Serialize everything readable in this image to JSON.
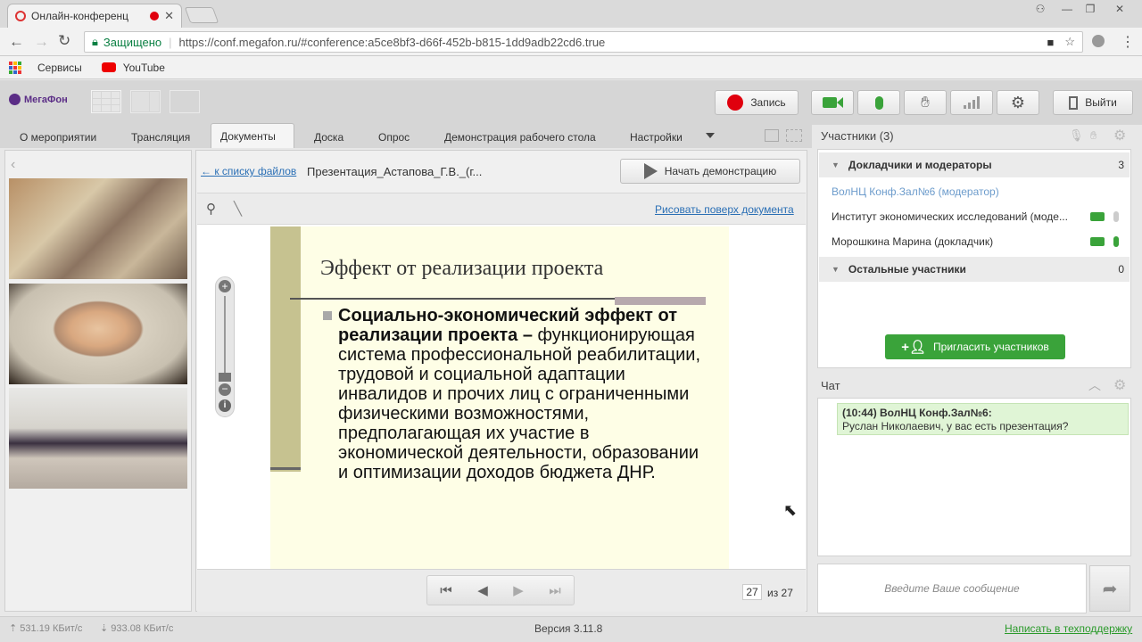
{
  "browser": {
    "tab_title": "Онлайн-конференц",
    "secure_label": "Защищено",
    "url": "https://conf.megafon.ru/#conference:a5ce8bf3-d66f-452b-b815-1dd9adb22cd6.true",
    "bookmarks": [
      {
        "label": "Сервисы"
      },
      {
        "label": "YouTube"
      }
    ]
  },
  "header": {
    "logo": "МегаФон",
    "record_label": "Запись",
    "logout_label": "Выйти"
  },
  "tabs": [
    {
      "label": "О мероприятии",
      "active": false
    },
    {
      "label": "Трансляция",
      "active": false
    },
    {
      "label": "Документы",
      "active": true
    },
    {
      "label": "Доска",
      "active": false
    },
    {
      "label": "Опрос",
      "active": false
    },
    {
      "label": "Демонстрация рабочего стола",
      "active": false
    },
    {
      "label": "Настройки",
      "active": false
    }
  ],
  "document": {
    "back_link": "← к списку файлов",
    "filename": "Презентация_Астапова_Г.В._(г...",
    "start_demo_label": "Начать демонстрацию",
    "draw_link": "Рисовать поверх документа",
    "slide": {
      "title": "Эффект от реализации проекта",
      "bold_text": "Социально-экономический эффект от  реализации проекта –",
      "body_text": "функционирующая система профессиональной реабилитации, трудовой и социальной адаптации инвалидов и прочих лиц с ограниченными физическими возможностями, предполагающая их участие в экономической деятельности, образовании и оптимизации доходов бюджета ДНР."
    },
    "current_page": "27",
    "of_label": "из 27"
  },
  "participants": {
    "title": "Участники (3)",
    "group1": {
      "label": "Докладчики и модераторы",
      "count": "3"
    },
    "members": [
      {
        "name": "ВолНЦ Конф.Зал№6 (модератор)",
        "highlight": true
      },
      {
        "name": "Институт экономических исследований (моде...",
        "highlight": false
      },
      {
        "name": "Морошкина Марина (докладчик)",
        "highlight": false
      }
    ],
    "group2": {
      "label": "Остальные участники",
      "count": "0"
    },
    "invite_label": "Пригласить участников"
  },
  "chat": {
    "title": "Чат",
    "message_header": "(10:44) ВолНЦ Конф.Зал№6:",
    "message_text": "Руслан Николаевич, у вас есть презентация?",
    "input_placeholder": "Введите Ваше сообщение"
  },
  "status": {
    "upload": "531.19 КБит/с",
    "download": "933.08 КБит/с",
    "version": "Версия 3.11.8",
    "support_link": "Написать в техподдержку"
  },
  "colors": {
    "accent_green": "#3aa33a",
    "link_blue": "#2a6fb5",
    "record_red": "#e0000e",
    "megafon_purple": "#5b2d86"
  }
}
